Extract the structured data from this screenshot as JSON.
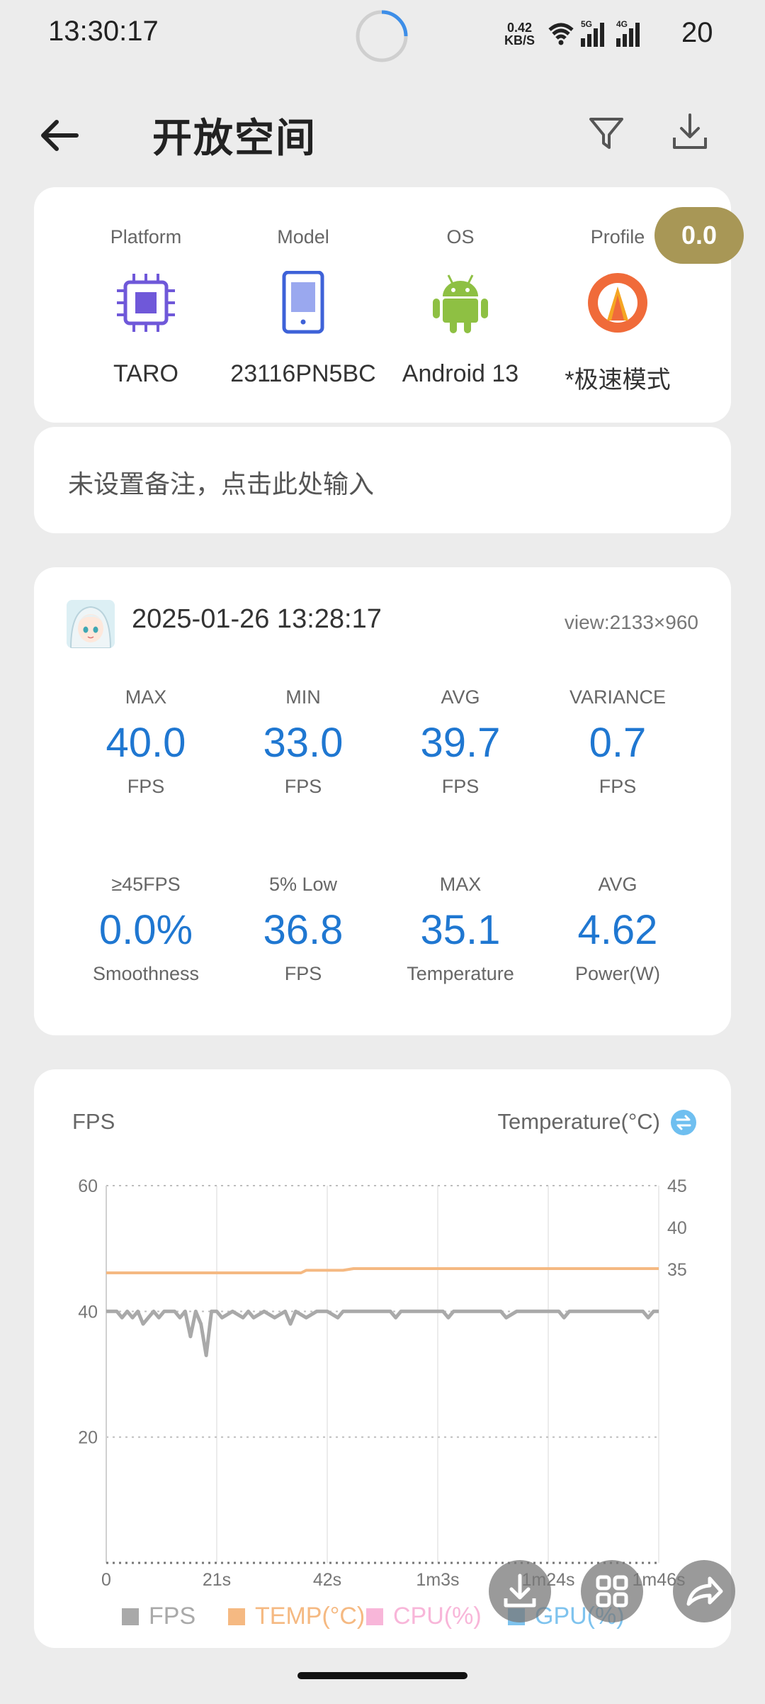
{
  "status": {
    "time": "13:30:17",
    "net_speed_top": "0.42",
    "net_speed_bottom": "KB/S",
    "network_5g": "5G",
    "network_4g": "4G",
    "battery": "20"
  },
  "header": {
    "title": "开放空间",
    "icons": [
      "back-arrow-icon",
      "filter-icon",
      "download-icon"
    ]
  },
  "device": {
    "columns": [
      {
        "label": "Platform",
        "value": "TARO",
        "icon": "chip-icon"
      },
      {
        "label": "Model",
        "value": "23116PN5BC",
        "icon": "phone-icon"
      },
      {
        "label": "OS",
        "value": "Android 13",
        "icon": "android-icon"
      },
      {
        "label": "Profile",
        "value": "*极速模式",
        "icon": "speed-mode-icon"
      }
    ],
    "profile_badge": "0.0"
  },
  "note": {
    "placeholder": "未设置备注，点击此处输入"
  },
  "session": {
    "datetime": "2025-01-26 13:28:17",
    "view": "view:2133×960",
    "stats": [
      {
        "label": "MAX",
        "value": "40.0",
        "unit": "FPS"
      },
      {
        "label": "MIN",
        "value": "33.0",
        "unit": "FPS"
      },
      {
        "label": "AVG",
        "value": "39.7",
        "unit": "FPS"
      },
      {
        "label": "VARIANCE",
        "value": "0.7",
        "unit": "FPS"
      },
      {
        "label": "≥45FPS",
        "value": "0.0%",
        "unit": "Smoothness"
      },
      {
        "label": "5% Low",
        "value": "36.8",
        "unit": "FPS"
      },
      {
        "label": "MAX",
        "value": "35.1",
        "unit": "Temperature"
      },
      {
        "label": "AVG",
        "value": "4.62",
        "unit": "Power(W)"
      }
    ]
  },
  "chart": {
    "left_title": "FPS",
    "right_title": "Temperature(°C)"
  },
  "chart_data": {
    "type": "line",
    "x_ticks": [
      "0",
      "21s",
      "42s",
      "1m3s",
      "1m24s",
      "1m46s"
    ],
    "y_left_ticks": [
      "60",
      "40",
      "20"
    ],
    "y_right_ticks": [
      "45",
      "40",
      "35"
    ],
    "ylim_left": [
      0,
      60
    ],
    "ylim_right": [
      0,
      45
    ],
    "xlim": [
      0,
      105
    ],
    "legend": [
      {
        "name": "FPS",
        "color": "#a9a9a9"
      },
      {
        "name": "TEMP(°C)",
        "color": "#f5b982"
      },
      {
        "name": "CPU(%)",
        "color": "#f8b6d9"
      },
      {
        "name": "GPU(%)",
        "color": "#7ec3ee"
      }
    ],
    "series": [
      {
        "name": "FPS",
        "axis": "left",
        "color": "#a9a9a9",
        "x": [
          0,
          2,
          3,
          4,
          5,
          6,
          7,
          8,
          9,
          10,
          11,
          12,
          13,
          14,
          15,
          16,
          17,
          18,
          19,
          20,
          21,
          22,
          24,
          26,
          27,
          28,
          30,
          32,
          34,
          35,
          36,
          38,
          40,
          42,
          44,
          45,
          46,
          48,
          50,
          52,
          54,
          55,
          56,
          58,
          60,
          62,
          64,
          65,
          66,
          68,
          70,
          72,
          74,
          75,
          76,
          78,
          80,
          82,
          84,
          86,
          87,
          88,
          90,
          92,
          94,
          96,
          98,
          100,
          102,
          103,
          104,
          105
        ],
        "y": [
          40,
          40,
          39,
          40,
          39,
          40,
          38,
          39,
          40,
          39,
          40,
          40,
          40,
          39,
          40,
          36,
          40,
          38,
          33,
          40,
          40,
          39,
          40,
          39,
          40,
          39,
          40,
          39,
          40,
          38,
          40,
          39,
          40,
          40,
          39,
          40,
          40,
          40,
          40,
          40,
          40,
          39,
          40,
          40,
          40,
          40,
          40,
          39,
          40,
          40,
          40,
          40,
          40,
          40,
          39,
          40,
          40,
          40,
          40,
          40,
          39,
          40,
          40,
          40,
          40,
          40,
          40,
          40,
          40,
          39,
          40,
          40
        ]
      },
      {
        "name": "TEMP(°C)",
        "axis": "right",
        "color": "#f5b982",
        "x": [
          0,
          10,
          20,
          30,
          37,
          38,
          40,
          45,
          47,
          50,
          60,
          70,
          80,
          90,
          100,
          105
        ],
        "y": [
          34.6,
          34.6,
          34.6,
          34.6,
          34.6,
          34.9,
          34.9,
          34.9,
          35.1,
          35.1,
          35.1,
          35.1,
          35.1,
          35.1,
          35.1,
          35.1
        ]
      }
    ]
  },
  "fabs": [
    "download-icon",
    "grid-icon",
    "share-icon"
  ]
}
